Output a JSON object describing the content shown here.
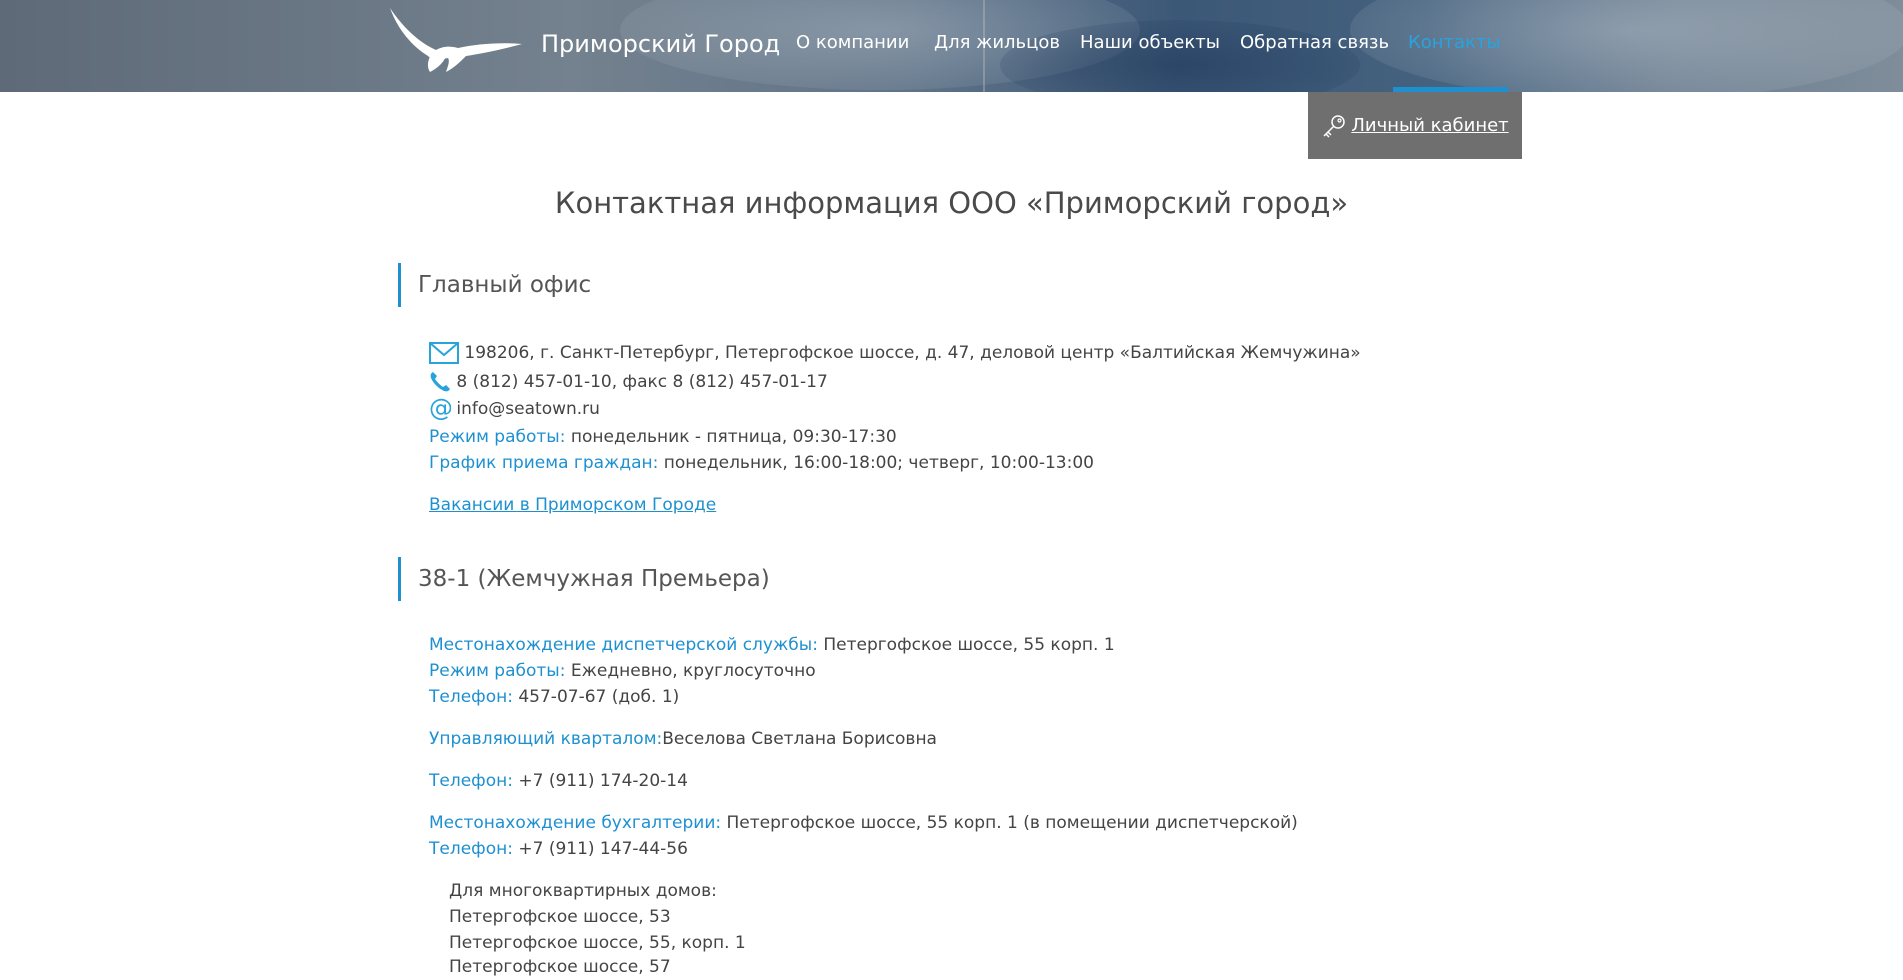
{
  "header": {
    "brand": "Приморский Город",
    "nav": [
      {
        "label": "О компании",
        "active": false
      },
      {
        "label": "Для жильцов",
        "active": false
      },
      {
        "label": "Наши объекты",
        "active": false
      },
      {
        "label": "Обратная связь",
        "active": false
      },
      {
        "label": "Контакты",
        "active": true
      }
    ],
    "accent_color": "#1e8fcf"
  },
  "cabinet": {
    "label": "Личный кабинет",
    "icon": "key-icon"
  },
  "page_title": "Контактная информация ООО «Приморский город»",
  "main_office": {
    "heading": "Главный офис",
    "address": "198206, г. Санкт-Петербург, Петергофское шоссе, д. 47, деловой центр «Балтийская Жемчужина»",
    "phone": "8 (812) 457-01-10, факс 8 (812) 457-01-17",
    "email": "info@seatown.ru",
    "hours_label": "Режим работы:",
    "hours_value": " понедельник - пятница, 09:30-17:30",
    "reception_label": "График приема граждан:",
    "reception_value": " понедельник, 16:00-18:00; четверг, 10:00-13:00",
    "vacancies_link": "Вакансии в Приморском Городе"
  },
  "quarter": {
    "heading": "38-1 (Жемчужная Премьера)",
    "dispatch_label": "Местонахождение диспетчерской службы:",
    "dispatch_value": " Петергофское шоссе, 55 корп. 1",
    "hours_label": "Режим работы:",
    "hours_value": " Ежедневно, круглосуточно",
    "phone1_label": "Телефон:",
    "phone1_value": " 457-07-67 (доб. 1)",
    "manager_label": "Управляющий кварталом:",
    "manager_value": "Веселова Светлана Борисовна",
    "phone2_label": "Телефон:",
    "phone2_value": " +7 (911) 174-20-14",
    "accounting_label": "Местонахождение бухгалтерии:",
    "accounting_value": " Петергофское шоссе, 55 корп. 1 (в помещении диспетчерской)",
    "phone3_label": "Телефон:",
    "phone3_value": " +7 (911) 147-44-56",
    "houses_title": "Для многоквартирных домов:",
    "houses": [
      "Петергофское шоссе, 53",
      "Петергофское шоссе, 55, корп. 1",
      "Петергофское шоссе, 57"
    ]
  }
}
